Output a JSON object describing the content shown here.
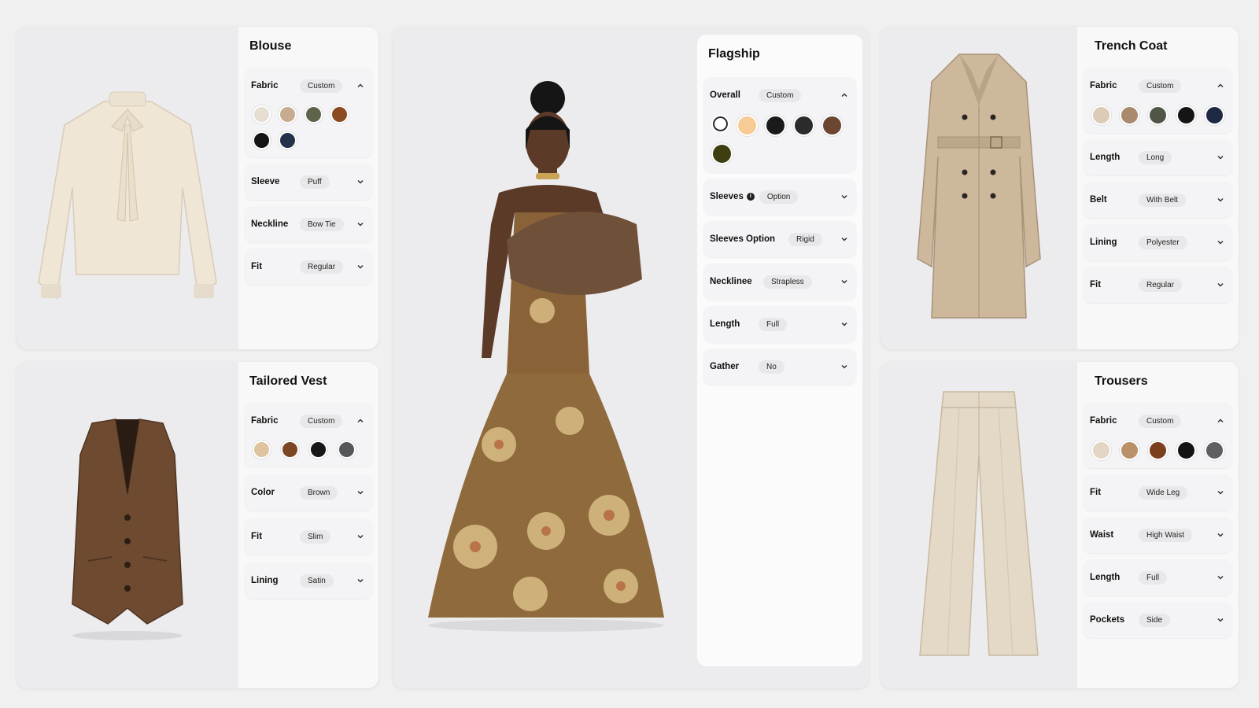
{
  "blouse": {
    "title": "Blouse",
    "fabric": {
      "label": "Fabric",
      "value": "Custom",
      "swatches": [
        "#e6ddd3",
        "#c7ac90",
        "#5e644c",
        "#8b4a20",
        "#141414",
        "#23324a"
      ]
    },
    "rows": [
      {
        "label": "Sleeve",
        "value": "Puff"
      },
      {
        "label": "Neckline",
        "value": "Bow Tie"
      },
      {
        "label": "Fit",
        "value": "Regular"
      }
    ]
  },
  "vest": {
    "title": "Tailored Vest",
    "fabric": {
      "label": "Fabric",
      "value": "Custom",
      "swatches": [
        "#ddc39e",
        "#7c4523",
        "#161616",
        "#55575a"
      ]
    },
    "rows": [
      {
        "label": "Color",
        "value": "Brown"
      },
      {
        "label": "Fit",
        "value": "Slim"
      },
      {
        "label": "Lining",
        "value": "Satin"
      }
    ]
  },
  "flagship": {
    "title": "Flagship",
    "overall": {
      "label": "Overall",
      "value": "Custom",
      "swatches": [
        "#ffffff",
        "#f6cb94",
        "#1a1a1a",
        "#2b2b2b",
        "#6b4630",
        "#3e3e10"
      ]
    },
    "rows": [
      {
        "label": "Sleeves",
        "value": "Option",
        "info": "i"
      },
      {
        "label": "Sleeves Option",
        "value": "Rigid"
      },
      {
        "label": "Necklinee",
        "value": "Strapless"
      },
      {
        "label": "Length",
        "value": "Full"
      },
      {
        "label": "Gather",
        "value": "No"
      }
    ]
  },
  "trench": {
    "title": "Trench Coat",
    "fabric": {
      "label": "Fabric",
      "value": "Custom",
      "swatches": [
        "#dccbb7",
        "#a98a6d",
        "#4f5647",
        "#151515",
        "#1e2a44"
      ]
    },
    "rows": [
      {
        "label": "Length",
        "value": "Long"
      },
      {
        "label": "Belt",
        "value": "With Belt"
      },
      {
        "label": "Lining",
        "value": "Polyester"
      },
      {
        "label": "Fit",
        "value": "Regular"
      }
    ]
  },
  "trousers": {
    "title": "Trousers",
    "fabric": {
      "label": "Fabric",
      "value": "Custom",
      "swatches": [
        "#e2d5c4",
        "#b99067",
        "#7c3f1d",
        "#131313",
        "#5d5f62"
      ]
    },
    "rows": [
      {
        "label": "Fit",
        "value": "Wide Leg"
      },
      {
        "label": "Waist",
        "value": "High Waist"
      },
      {
        "label": "Length",
        "value": "Full"
      },
      {
        "label": "Pockets",
        "value": "Side"
      }
    ]
  }
}
